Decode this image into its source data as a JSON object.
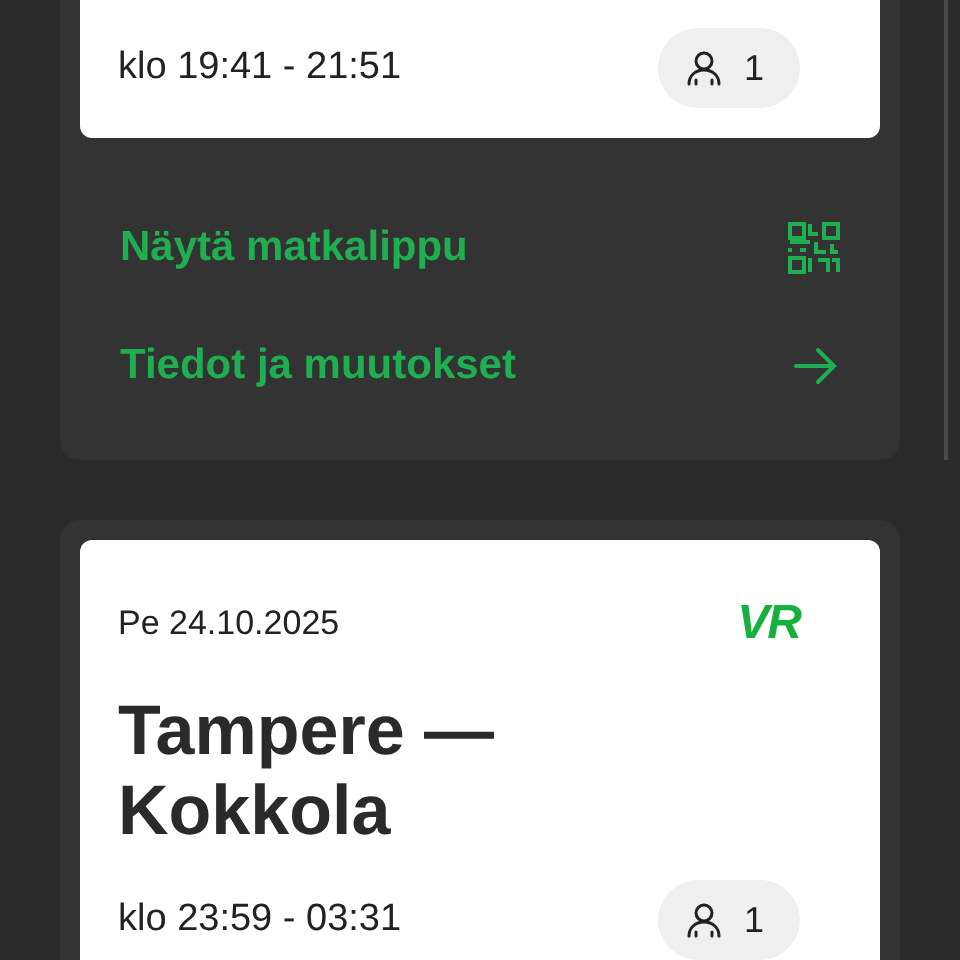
{
  "trips": [
    {
      "time": "klo 19:41 - 21:51",
      "passengers": "1",
      "actions": [
        {
          "kind": "qr",
          "label": "Näytä matkalippu"
        },
        {
          "kind": "arrow",
          "label": "Tiedot ja muutokset"
        }
      ]
    },
    {
      "date": "Pe 24.10.2025",
      "operator_logo": "VR",
      "route": "Tampere — Kokkola",
      "time": "klo 23:59 - 03:31",
      "passengers": "1"
    }
  ]
}
